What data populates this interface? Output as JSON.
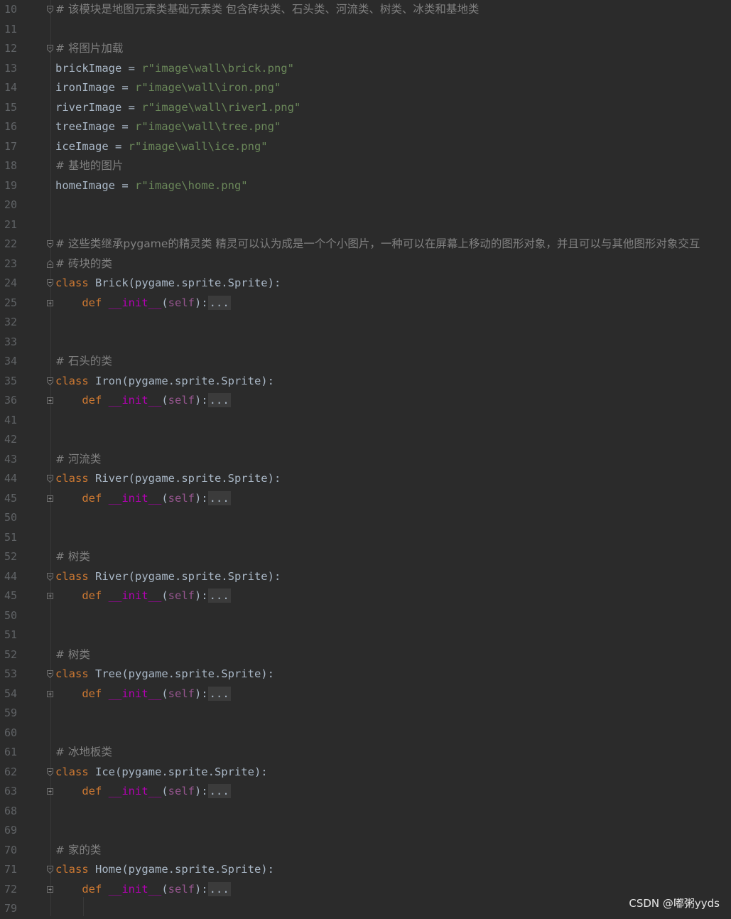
{
  "lines": [
    {
      "num": "10",
      "fold": "open",
      "code": [
        {
          "t": "cm",
          "v": "# 该模块是地图元素类基础元素类 包含砖块类、石头类、河流类、树类、冰类和基地类"
        }
      ]
    },
    {
      "num": "11",
      "fold": "",
      "code": []
    },
    {
      "num": "12",
      "fold": "open",
      "code": [
        {
          "t": "cm",
          "v": "# 将图片加载"
        }
      ]
    },
    {
      "num": "13",
      "fold": "",
      "code": [
        {
          "t": "pl",
          "v": "brickImage = "
        },
        {
          "t": "str",
          "v": "r\"image\\wall\\brick.png\""
        }
      ]
    },
    {
      "num": "14",
      "fold": "",
      "code": [
        {
          "t": "pl",
          "v": "ironImage = "
        },
        {
          "t": "str",
          "v": "r\"image\\wall\\iron.png\""
        }
      ]
    },
    {
      "num": "15",
      "fold": "",
      "code": [
        {
          "t": "pl",
          "v": "riverImage = "
        },
        {
          "t": "str",
          "v": "r\"image\\wall\\river1.png\""
        }
      ]
    },
    {
      "num": "16",
      "fold": "",
      "code": [
        {
          "t": "pl",
          "v": "treeImage = "
        },
        {
          "t": "str",
          "v": "r\"image\\wall\\tree.png\""
        }
      ]
    },
    {
      "num": "17",
      "fold": "",
      "code": [
        {
          "t": "pl",
          "v": "iceImage = "
        },
        {
          "t": "str",
          "v": "r\"image\\wall\\ice.png\""
        }
      ]
    },
    {
      "num": "18",
      "fold": "",
      "code": [
        {
          "t": "cm",
          "v": "# 基地的图片"
        }
      ]
    },
    {
      "num": "19",
      "fold": "",
      "code": [
        {
          "t": "pl",
          "v": "homeImage = "
        },
        {
          "t": "str",
          "v": "r\"image\\home.png\""
        }
      ]
    },
    {
      "num": "20",
      "fold": "",
      "code": []
    },
    {
      "num": "21",
      "fold": "",
      "code": []
    },
    {
      "num": "22",
      "fold": "open",
      "code": [
        {
          "t": "cm",
          "v": "# 这些类继承pygame的精灵类 精灵可以认为成是一个个小图片，一种可以在屏幕上移动的图形对象，并且可以与其他图形对象交互"
        }
      ]
    },
    {
      "num": "23",
      "fold": "close",
      "code": [
        {
          "t": "cm",
          "v": "# 砖块的类"
        }
      ]
    },
    {
      "num": "24",
      "fold": "open",
      "code": [
        {
          "t": "kw",
          "v": "class "
        },
        {
          "t": "pl",
          "v": "Brick(pygame.sprite.Sprite):"
        }
      ]
    },
    {
      "num": "25",
      "fold": "plus",
      "code": [
        {
          "t": "pl",
          "v": "    "
        },
        {
          "t": "kw",
          "v": "def "
        },
        {
          "t": "fn",
          "v": "__init__"
        },
        {
          "t": "pl",
          "v": "("
        },
        {
          "t": "self",
          "v": "self"
        },
        {
          "t": "pl",
          "v": "):"
        },
        {
          "t": "ell",
          "v": "..."
        }
      ]
    },
    {
      "num": "32",
      "fold": "",
      "code": []
    },
    {
      "num": "33",
      "fold": "",
      "code": []
    },
    {
      "num": "34",
      "fold": "",
      "code": [
        {
          "t": "cm",
          "v": "# 石头的类"
        }
      ]
    },
    {
      "num": "35",
      "fold": "open",
      "code": [
        {
          "t": "kw",
          "v": "class "
        },
        {
          "t": "pl",
          "v": "Iron(pygame.sprite.Sprite):"
        }
      ]
    },
    {
      "num": "36",
      "fold": "plus",
      "code": [
        {
          "t": "pl",
          "v": "    "
        },
        {
          "t": "kw",
          "v": "def "
        },
        {
          "t": "fn",
          "v": "__init__"
        },
        {
          "t": "pl",
          "v": "("
        },
        {
          "t": "self",
          "v": "self"
        },
        {
          "t": "pl",
          "v": "):"
        },
        {
          "t": "ell",
          "v": "..."
        }
      ]
    },
    {
      "num": "41",
      "fold": "",
      "code": []
    },
    {
      "num": "42",
      "fold": "",
      "code": []
    },
    {
      "num": "43",
      "fold": "",
      "code": [
        {
          "t": "cm",
          "v": "# 河流类"
        }
      ]
    },
    {
      "num": "44",
      "fold": "open",
      "code": [
        {
          "t": "kw",
          "v": "class "
        },
        {
          "t": "pl",
          "v": "River(pygame.sprite.Sprite):"
        }
      ]
    },
    {
      "num": "45",
      "fold": "plus",
      "code": [
        {
          "t": "pl",
          "v": "    "
        },
        {
          "t": "kw",
          "v": "def "
        },
        {
          "t": "fn",
          "v": "__init__"
        },
        {
          "t": "pl",
          "v": "("
        },
        {
          "t": "self",
          "v": "self"
        },
        {
          "t": "pl",
          "v": "):"
        },
        {
          "t": "ell",
          "v": "..."
        }
      ]
    },
    {
      "num": "50",
      "fold": "",
      "code": []
    },
    {
      "num": "51",
      "fold": "",
      "code": []
    },
    {
      "num": "52",
      "fold": "",
      "code": [
        {
          "t": "cm",
          "v": "# 树类"
        }
      ]
    },
    {
      "num": "44",
      "fold": "open",
      "code": [
        {
          "t": "kw",
          "v": "class "
        },
        {
          "t": "pl",
          "v": "River(pygame.sprite.Sprite):"
        }
      ]
    },
    {
      "num": "45",
      "fold": "plus",
      "code": [
        {
          "t": "pl",
          "v": "    "
        },
        {
          "t": "kw",
          "v": "def "
        },
        {
          "t": "fn",
          "v": "__init__"
        },
        {
          "t": "pl",
          "v": "("
        },
        {
          "t": "self",
          "v": "self"
        },
        {
          "t": "pl",
          "v": "):"
        },
        {
          "t": "ell",
          "v": "..."
        }
      ]
    },
    {
      "num": "50",
      "fold": "",
      "code": []
    },
    {
      "num": "51",
      "fold": "",
      "code": []
    },
    {
      "num": "52",
      "fold": "",
      "code": [
        {
          "t": "cm",
          "v": "# 树类"
        }
      ]
    },
    {
      "num": "53",
      "fold": "open",
      "code": [
        {
          "t": "kw",
          "v": "class "
        },
        {
          "t": "pl",
          "v": "Tree(pygame.sprite.Sprite):"
        }
      ]
    },
    {
      "num": "54",
      "fold": "plus",
      "code": [
        {
          "t": "pl",
          "v": "    "
        },
        {
          "t": "kw",
          "v": "def "
        },
        {
          "t": "fn",
          "v": "__init__"
        },
        {
          "t": "pl",
          "v": "("
        },
        {
          "t": "self",
          "v": "self"
        },
        {
          "t": "pl",
          "v": "):"
        },
        {
          "t": "ell",
          "v": "..."
        }
      ]
    },
    {
      "num": "59",
      "fold": "",
      "code": []
    },
    {
      "num": "60",
      "fold": "",
      "code": []
    },
    {
      "num": "61",
      "fold": "",
      "code": [
        {
          "t": "cm",
          "v": "# 冰地板类"
        }
      ]
    },
    {
      "num": "62",
      "fold": "open",
      "code": [
        {
          "t": "kw",
          "v": "class "
        },
        {
          "t": "pl",
          "v": "Ice(pygame.sprite.Sprite):"
        }
      ]
    },
    {
      "num": "63",
      "fold": "plus",
      "code": [
        {
          "t": "pl",
          "v": "    "
        },
        {
          "t": "kw",
          "v": "def "
        },
        {
          "t": "fn",
          "v": "__init__"
        },
        {
          "t": "pl",
          "v": "("
        },
        {
          "t": "self",
          "v": "self"
        },
        {
          "t": "pl",
          "v": "):"
        },
        {
          "t": "ell",
          "v": "..."
        }
      ]
    },
    {
      "num": "68",
      "fold": "",
      "code": []
    },
    {
      "num": "69",
      "fold": "",
      "code": []
    },
    {
      "num": "70",
      "fold": "",
      "code": [
        {
          "t": "cm",
          "v": "# 家的类"
        }
      ]
    },
    {
      "num": "71",
      "fold": "open",
      "code": [
        {
          "t": "kw",
          "v": "class "
        },
        {
          "t": "pl",
          "v": "Home(pygame.sprite.Sprite):"
        }
      ]
    },
    {
      "num": "72",
      "fold": "plus",
      "code": [
        {
          "t": "pl",
          "v": "    "
        },
        {
          "t": "kw",
          "v": "def "
        },
        {
          "t": "fn",
          "v": "__init__"
        },
        {
          "t": "pl",
          "v": "("
        },
        {
          "t": "self",
          "v": "self"
        },
        {
          "t": "pl",
          "v": "):"
        },
        {
          "t": "ell",
          "v": "..."
        }
      ]
    },
    {
      "num": "79",
      "fold": "",
      "code": []
    }
  ],
  "watermark": "CSDN @嘟粥yyds",
  "colors": {
    "background": "#2b2b2b",
    "comment": "#808080",
    "keyword": "#cc7832",
    "string": "#6a8759",
    "dunder": "#b200b2",
    "self": "#94558d",
    "plain": "#a9b7c6",
    "gutter": "#606366"
  }
}
